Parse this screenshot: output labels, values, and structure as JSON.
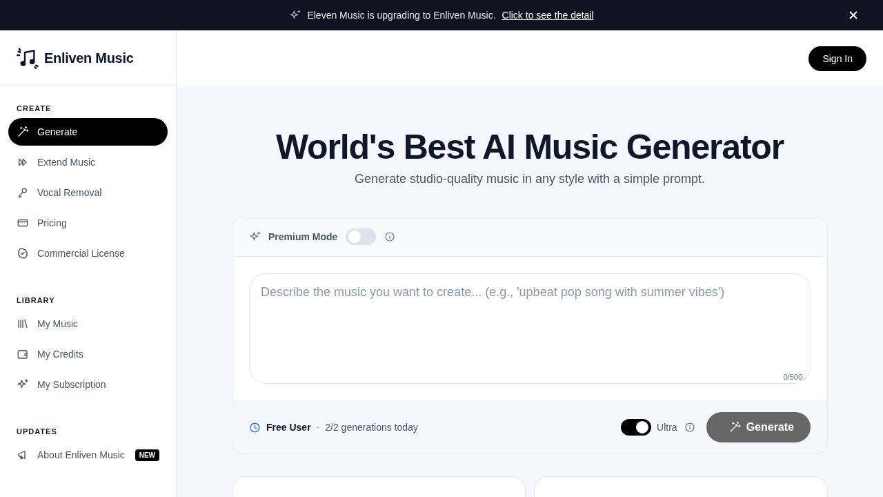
{
  "banner": {
    "message": "Eleven Music is upgrading to Enliven Music.",
    "link": "Click to see the detail"
  },
  "logo": {
    "name": "Enliven Music"
  },
  "sidebar": {
    "sections": [
      {
        "title": "CREATE",
        "items": [
          {
            "label": "Generate",
            "selected": true
          },
          {
            "label": "Extend Music",
            "selected": false
          },
          {
            "label": "Vocal Removal",
            "selected": false
          },
          {
            "label": "Pricing",
            "selected": false
          },
          {
            "label": "Commercial License",
            "selected": false
          }
        ]
      },
      {
        "title": "LIBRARY",
        "items": [
          {
            "label": "My Music",
            "selected": false
          },
          {
            "label": "My Credits",
            "selected": false
          },
          {
            "label": "My Subscription",
            "selected": false
          }
        ]
      },
      {
        "title": "UPDATES",
        "items": [
          {
            "label": "About Enliven Music",
            "selected": false,
            "badge": "NEW"
          }
        ]
      }
    ]
  },
  "header": {
    "sign_in": "Sign In"
  },
  "hero": {
    "title": "World's Best AI Music Generator",
    "subtitle": "Generate studio-quality music in any style with a simple prompt."
  },
  "generator": {
    "premium_mode": {
      "label": "Premium Mode",
      "on": false
    },
    "prompt": {
      "placeholder": "Describe the music you want to create... (e.g., 'upbeat pop song with summer vibes')",
      "counter": "0/500"
    },
    "plan": "Free User",
    "separator": "-",
    "usage": "2/2 generations today",
    "ultra": {
      "label": "Ultra",
      "on": true
    },
    "generate_button": {
      "label": "Generate",
      "disabled": true
    }
  },
  "examples": [
    {
      "kind": "card"
    },
    {
      "kind": "card"
    }
  ]
}
